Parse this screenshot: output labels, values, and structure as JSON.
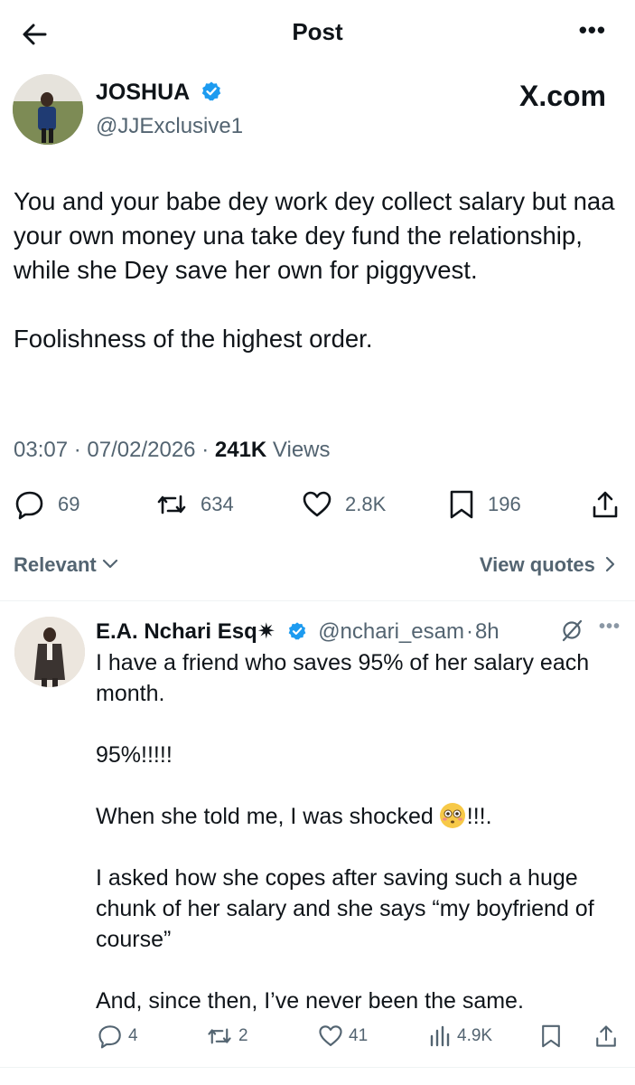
{
  "header": {
    "title": "Post",
    "back_icon": "arrow-left-icon",
    "more_icon": "more-horizontal-icon",
    "more_label": "•••"
  },
  "tweet": {
    "author_name": "JOSHUA",
    "author_handle": "@JJExclusive1",
    "watermark": "X.com",
    "paragraphs": [
      "You and your babe dey work dey collect salary but naa your own money una take dey fund the relationship, while she Dey save her own for piggyvest.",
      "Foolishness of the highest order."
    ],
    "time": "03:07",
    "date": "07/02/2026",
    "views_count": "241K",
    "views_label": "Views",
    "separator": "·",
    "stats": {
      "replies": "69",
      "reposts": "634",
      "likes": "2.8K",
      "bookmarks": "196"
    }
  },
  "sort": {
    "relevant_label": "Relevant",
    "view_quotes_label": "View quotes"
  },
  "reply": {
    "author_name": "E.A. Nchari Esq✷",
    "author_handle": "@nchari_esam",
    "time": "8h",
    "separator": "·",
    "paragraphs": [
      "I have a friend who saves 95% of her salary each month.",
      "95%!!!!!",
      "When she told me, I was shocked",
      "!!!.",
      "I asked how she copes after saving such a huge chunk of her salary and she says “my boyfriend of course”",
      "And, since then, I’ve never been the same."
    ],
    "stats": {
      "replies": "4",
      "reposts": "2",
      "likes": "41",
      "views": "4.9K"
    }
  },
  "colors": {
    "text": "#0f1419",
    "muted": "#536471",
    "verified": "#1d9bf0",
    "divider": "#eff3f4"
  }
}
